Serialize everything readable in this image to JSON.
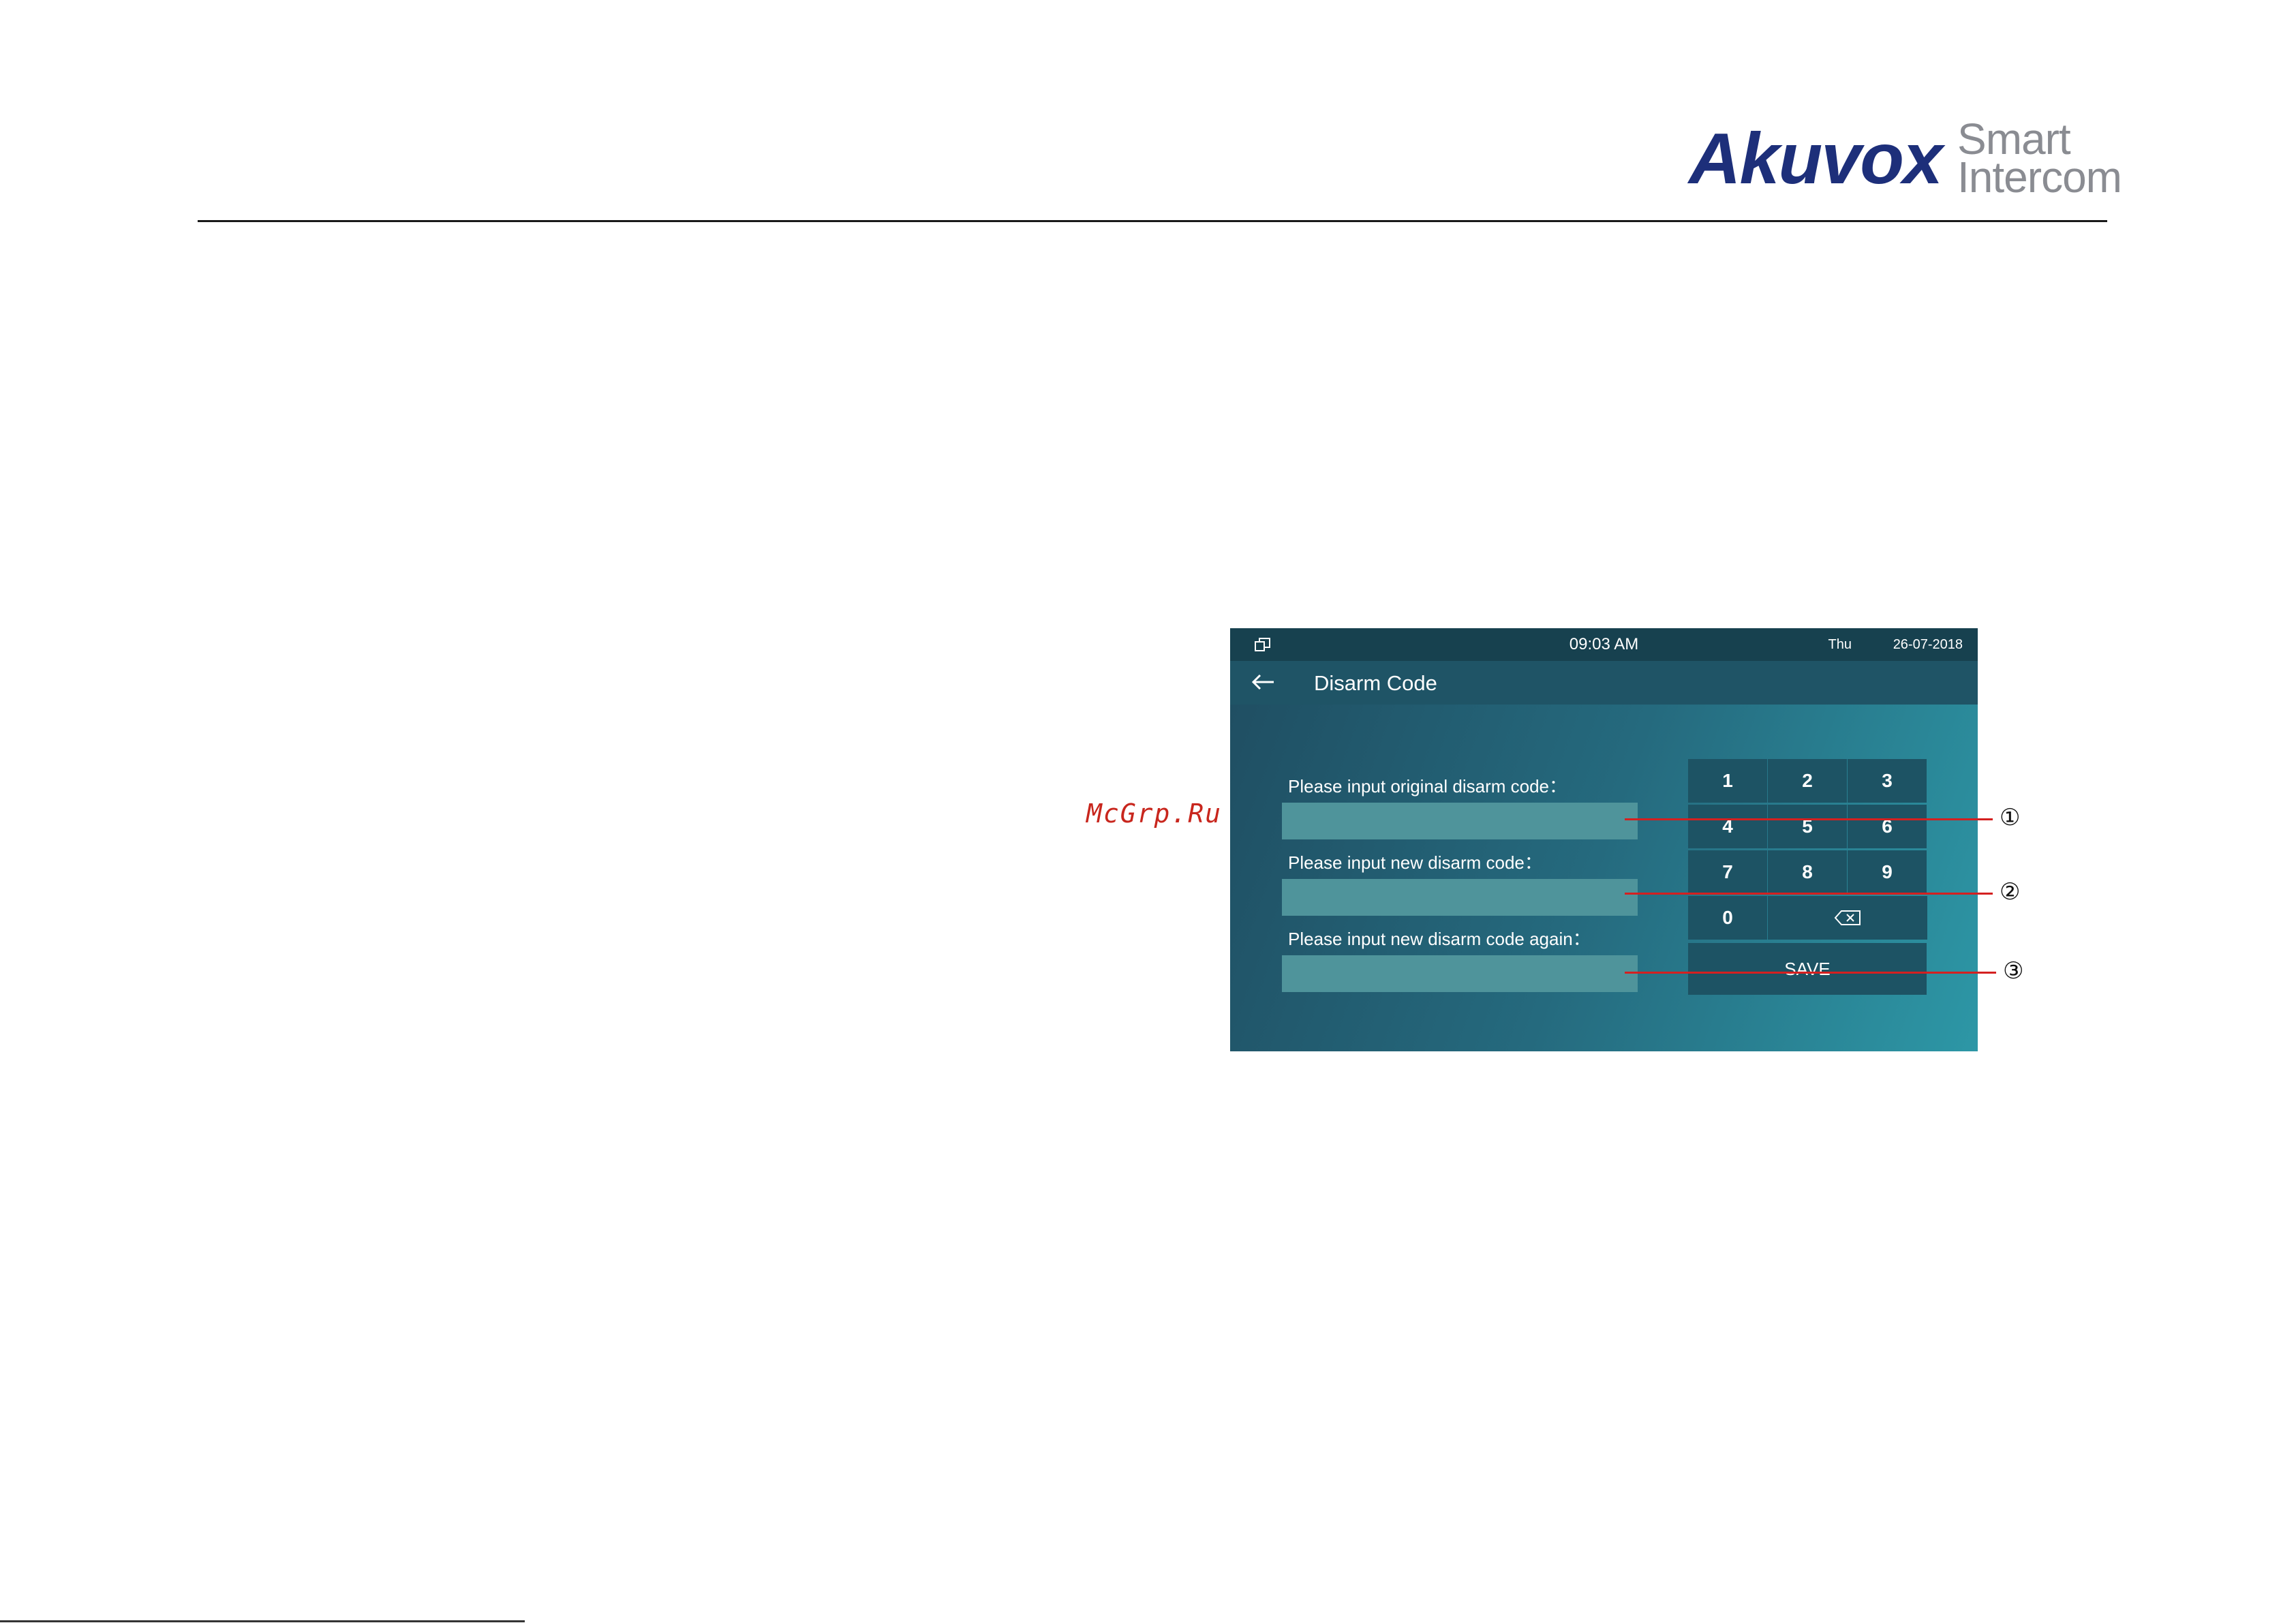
{
  "brand": {
    "name": "Akuvox",
    "line1": "Smart",
    "line2": "Intercom"
  },
  "watermark": "McGrp.Ru",
  "device": {
    "status_bar": {
      "time": "09:03 AM",
      "day": "Thu",
      "date": "26-07-2018",
      "left_icon": "window-restore-icon"
    },
    "title_bar": {
      "back_icon": "arrow-left-icon",
      "title": "Disarm Code"
    },
    "fields": [
      {
        "label": "Please input original disarm code：",
        "value": ""
      },
      {
        "label": "Please input new disarm code：",
        "value": ""
      },
      {
        "label": "Please input new disarm code again：",
        "value": ""
      }
    ],
    "keypad": {
      "keys": [
        "1",
        "2",
        "3",
        "4",
        "5",
        "6",
        "7",
        "8",
        "9",
        "0"
      ],
      "delete_icon": "backspace-icon",
      "save_label": "SAVE"
    }
  },
  "callouts": [
    "①",
    "②",
    "③"
  ],
  "colors": {
    "brand": "#1d2f7a",
    "callout_line": "#d42020",
    "screen_teal": "#256a7e"
  }
}
